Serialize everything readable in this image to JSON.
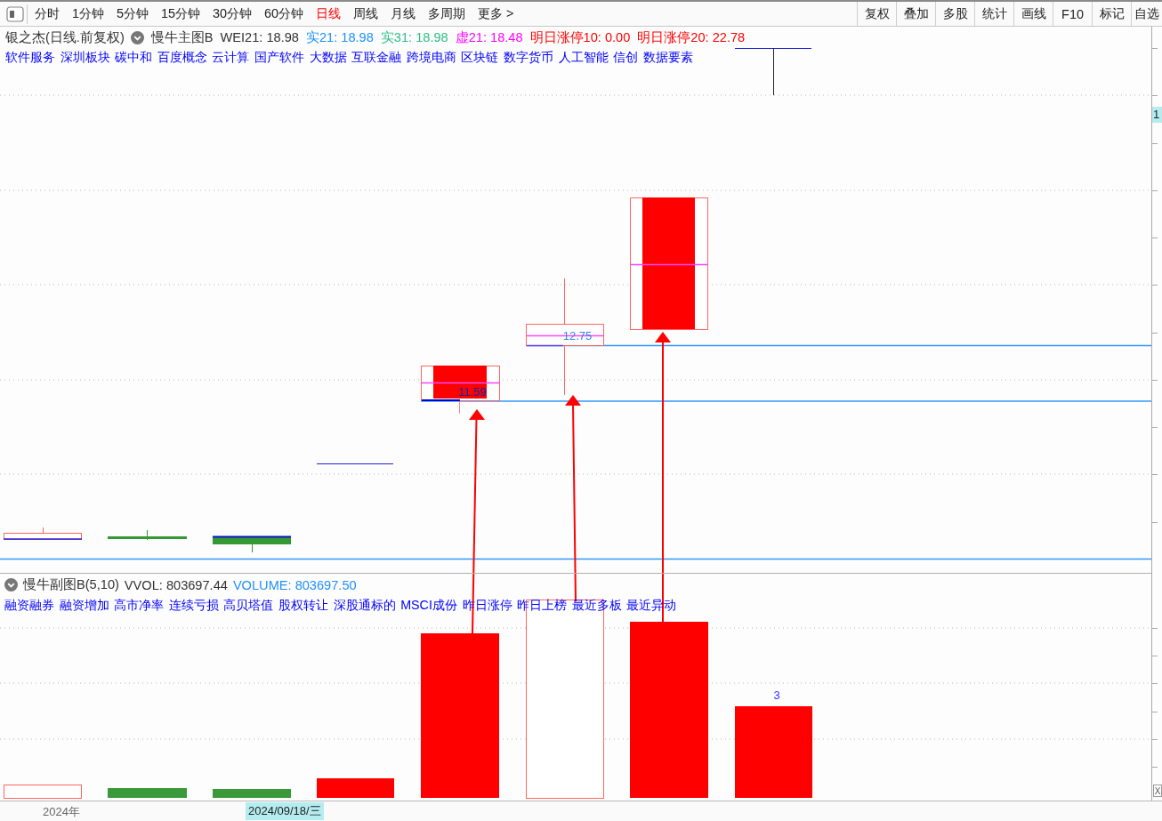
{
  "toolbar": {
    "tabs": [
      {
        "label": "分时",
        "selected": false
      },
      {
        "label": "1分钟",
        "selected": false
      },
      {
        "label": "5分钟",
        "selected": false
      },
      {
        "label": "15分钟",
        "selected": false
      },
      {
        "label": "30分钟",
        "selected": false
      },
      {
        "label": "60分钟",
        "selected": false
      },
      {
        "label": "日线",
        "selected": true
      },
      {
        "label": "周线",
        "selected": false
      },
      {
        "label": "月线",
        "selected": false
      },
      {
        "label": "多周期",
        "selected": false
      },
      {
        "label": "更多 >",
        "selected": false
      }
    ],
    "tools": [
      "复权",
      "叠加",
      "多股",
      "统计",
      "画线",
      "F10",
      "标记",
      "自选"
    ]
  },
  "main_chart": {
    "title": "银之杰(日线.前复权)",
    "indicator": "慢牛主图B",
    "readings": [
      {
        "text": "WEI21: 18.98",
        "color": "#333333"
      },
      {
        "text": "实21: 18.98",
        "color": "#1e90ff"
      },
      {
        "text": "实31: 18.98",
        "color": "#2dbf86"
      },
      {
        "text": "虚21: 18.48",
        "color": "#ff00ff"
      },
      {
        "text": "明日涨停10: 0.00",
        "color": "#ff0000"
      },
      {
        "text": "明日涨停20: 22.78",
        "color": "#ff0000"
      }
    ],
    "concepts": [
      "软件服务",
      "深圳板块",
      "碳中和",
      "百度概念",
      "云计算",
      "国产软件",
      "大数据",
      "互联金融",
      "跨境电商",
      "区块链",
      "数字货币",
      "人工智能",
      "信创",
      "数据要素"
    ],
    "price_labels": [
      "11.59",
      "12.75"
    ]
  },
  "volume_chart": {
    "indicator": "慢牛副图B(5,10)",
    "readings": [
      {
        "text": "VVOL: 803697.44",
        "color": "#333333"
      },
      {
        "text": "VOLUME: 803697.50",
        "color": "#1e90ff"
      }
    ],
    "tags": [
      "融资融券",
      "融资增加",
      "高市净率",
      "连续亏损",
      "高贝塔值",
      "股权转让",
      "深股通标的",
      "MSCI成份",
      "昨日涨停",
      "昨日上榜",
      "最近多板",
      "最近异动"
    ],
    "bar_label": "3"
  },
  "price_axis": {
    "cursor_label": "1",
    "corner_label": "X"
  },
  "time_axis": {
    "year_label": "2024年",
    "cursor_date": "2024/09/18/三"
  }
}
